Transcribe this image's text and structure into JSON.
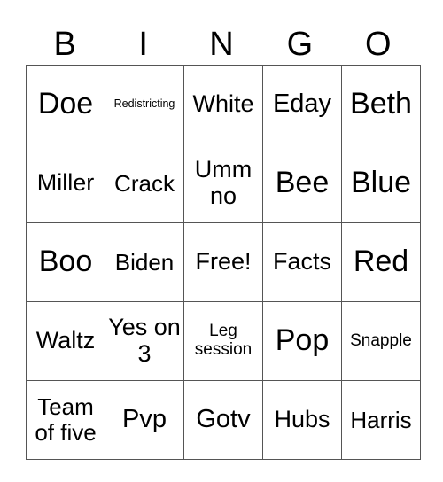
{
  "header": [
    "B",
    "I",
    "N",
    "G",
    "O"
  ],
  "rows": [
    [
      "Doe",
      "Redistricting",
      "White",
      "Eday",
      "Beth"
    ],
    [
      "Miller",
      "Crack",
      "Umm no",
      "Bee",
      "Blue"
    ],
    [
      "Boo",
      "Biden",
      "Free!",
      "Facts",
      "Red"
    ],
    [
      "Waltz",
      "Yes on 3",
      "Leg session",
      "Pop",
      "Snapple"
    ],
    [
      "Team of five",
      "Pvp",
      "Gotv",
      "Hubs",
      "Harris"
    ]
  ]
}
